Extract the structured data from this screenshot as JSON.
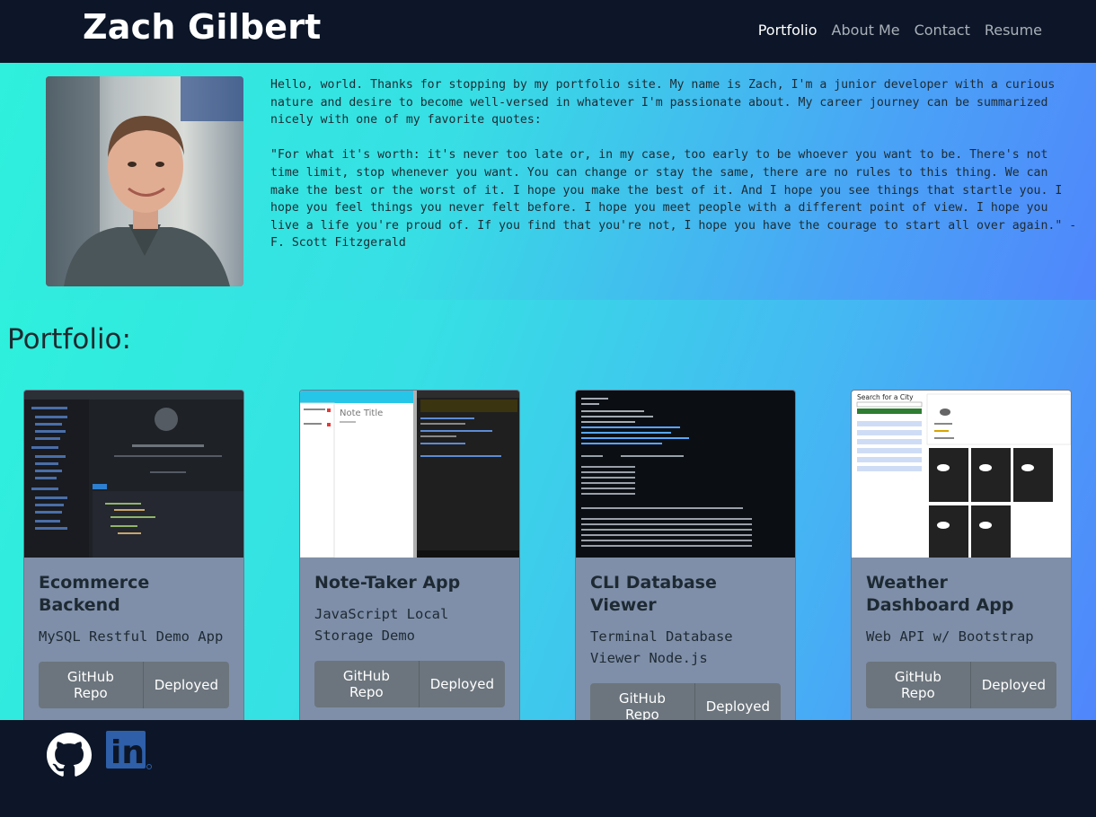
{
  "header": {
    "brand": "Zach Gilbert",
    "nav": [
      {
        "label": "Portfolio",
        "active": true
      },
      {
        "label": "About Me",
        "active": false
      },
      {
        "label": "Contact",
        "active": false
      },
      {
        "label": "Resume",
        "active": false
      }
    ]
  },
  "about": {
    "intro": "Hello, world. Thanks for stopping by my portfolio site. My name is Zach, I'm a junior developer with a curious nature and desire to become well-versed in whatever I'm passionate about. My career journey can be summarized nicely with one of my favorite quotes:",
    "quote": "\"For what it's worth: it's never too late or, in my case, too early to be whoever you want to be. There's not time limit, stop whenever you want. You can change or stay the same, there are no rules to this thing. We can make the best or the worst of it. I hope you make the best of it. And I hope you see things that startle you. I hope you feel things you never felt before. I hope you meet people with a different point of view. I hope you live a life you're proud of. If you find that you're not, I hope you have the courage to start all over again.\" -F. Scott Fitzgerald"
  },
  "portfolio": {
    "title": "Portfolio:",
    "cards": [
      {
        "title": "Ecommerce Backend",
        "text": "MySQL Restful Demo App",
        "repo_label": "GitHub Repo",
        "deploy_label": "Deployed"
      },
      {
        "title": "Note-Taker App",
        "text": "JavaScript Local Storage Demo",
        "repo_label": "GitHub Repo",
        "deploy_label": "Deployed"
      },
      {
        "title": "CLI Database Viewer",
        "text": "Terminal Database Viewer Node.js",
        "repo_label": "GitHub Repo",
        "deploy_label": "Deployed"
      },
      {
        "title": "Weather Dashboard App",
        "text": "Web API w/ Bootstrap",
        "repo_label": "GitHub Repo",
        "deploy_label": "Deployed"
      }
    ],
    "screenshots": {
      "note_title": "Note Title",
      "weather_search": "Search for a City"
    }
  },
  "footer": {
    "icons": [
      "github-icon",
      "linkedin-icon"
    ],
    "linkedin_text": "in"
  },
  "colors": {
    "navy": "#0c1628",
    "teal": "#2ef0dc",
    "blue": "#5086fc",
    "card": "#7f8fa9",
    "button": "#6c757d"
  }
}
